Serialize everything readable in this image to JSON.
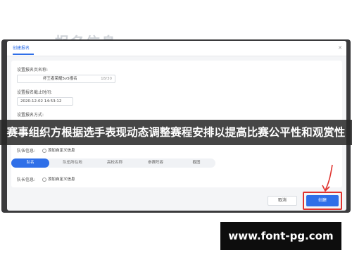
{
  "background_heading": "报名信息",
  "dialog": {
    "tab_label": "创建报名",
    "fields": {
      "name_label": "设置报名页名称:",
      "name_value": "杯王者荣耀5v5报名",
      "name_counter": "18/30",
      "deadline_label": "设置报名截止时间:",
      "deadline_value": "2020-12-02 14:53:12",
      "mode_label": "设置报名方式:"
    },
    "team_info_label": "队伍信息:",
    "add_custom_info": "添加自定义信息",
    "segments": [
      "队名",
      "队伍所在地",
      "高校名称",
      "参赛阵容",
      "截图"
    ],
    "captain_info_label": "队长信息:",
    "add_custom_info_2": "添加自定义信息"
  },
  "footer": {
    "cancel_label": "取消",
    "create_label": "创建"
  },
  "banner": {
    "title": "赛事组织方根据选手表现动态调整赛程安排以提高比赛公平性和观赏性"
  },
  "watermark": {
    "text": "www.font-pg.com"
  },
  "colors": {
    "accent": "#2f6fe8",
    "highlight": "#e0332e",
    "banner_bg": "#282828"
  }
}
